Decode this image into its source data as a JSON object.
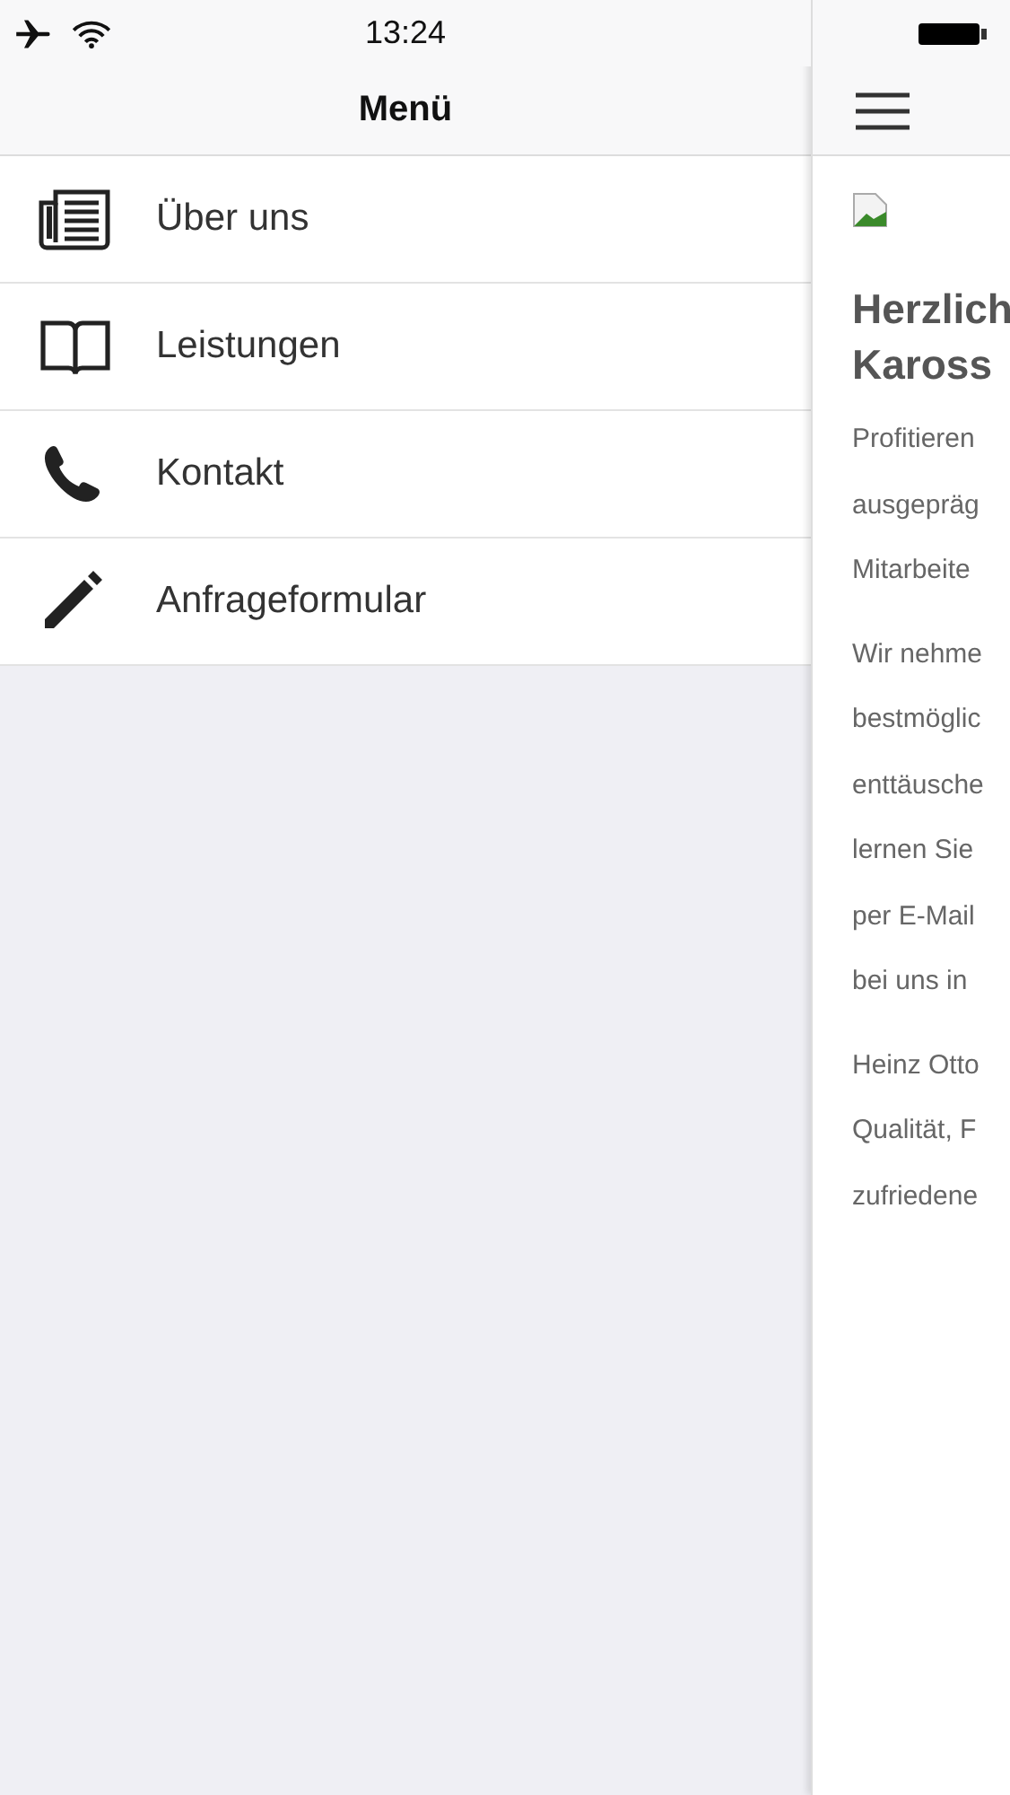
{
  "status_bar": {
    "time": "13:24"
  },
  "menu": {
    "title": "Menü",
    "items": [
      {
        "label": "Über uns",
        "kind": "newspaper"
      },
      {
        "label": "Leistungen",
        "kind": "book"
      },
      {
        "label": "Kontakt",
        "kind": "phone"
      },
      {
        "label": "Anfrageformular",
        "kind": "pencil"
      }
    ]
  },
  "content": {
    "image": {
      "kind": "broken-image"
    },
    "heading_lines": [
      "Herzlich",
      "Kaross"
    ],
    "paragraphs": [
      [
        "Profitieren",
        "ausgepräg",
        "Mitarbeite"
      ],
      [
        "Wir nehme",
        "bestmöglic",
        "enttäusche",
        "lernen Sie",
        "per E-Mail",
        "bei uns in"
      ],
      [
        "Heinz Otto",
        "Qualität, F",
        "zufriedene"
      ]
    ]
  }
}
